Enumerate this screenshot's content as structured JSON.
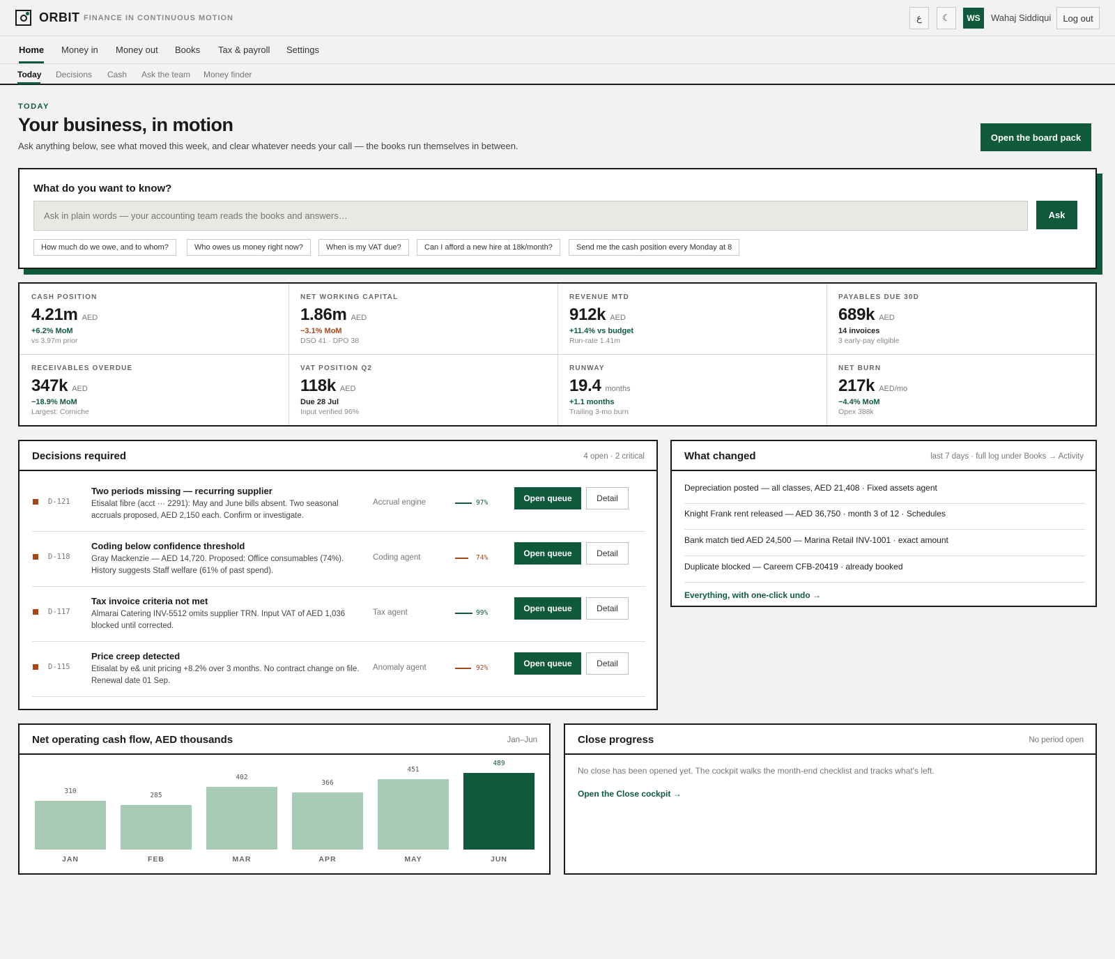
{
  "header": {
    "brand": "ORBIT",
    "tagline": "FINANCE IN CONTINUOUS MOTION",
    "lang_toggle": "ع",
    "theme_toggle": "☾",
    "avatar_initials": "WS",
    "user_name": "Wahaj Siddiqui",
    "logout_label": "Log out"
  },
  "nav": {
    "items": [
      "Home",
      "Money in",
      "Money out",
      "Books",
      "Tax & payroll",
      "Settings"
    ],
    "active": "Home"
  },
  "subnav": {
    "items": [
      "Today",
      "Decisions",
      "Cash",
      "Ask the team",
      "Money finder"
    ],
    "active": "Today"
  },
  "hero": {
    "eyebrow": "TODAY",
    "title": "Your business, in motion",
    "subtitle": "Ask anything below, see what moved this week, and clear whatever needs your call — the books run themselves in between.",
    "board_button": "Open the board pack"
  },
  "ask": {
    "title": "What do you want to know?",
    "placeholder": "Ask in plain words — your accounting team reads the books and answers…",
    "button": "Ask",
    "suggestions": [
      "How much do we owe, and to whom?",
      "Who owes us money right now?",
      "When is my VAT due?",
      "Can I afford a new hire at 18k/month?",
      "Send me the cash position every Monday at 8"
    ]
  },
  "kpis": [
    {
      "label": "CASH POSITION",
      "value": "4.21m",
      "unit": "AED",
      "delta": "+6.2% MoM",
      "note": "vs 3.97m prior"
    },
    {
      "label": "NET WORKING CAPITAL",
      "value": "1.86m",
      "unit": "AED",
      "delta": "−3.1% MoM",
      "note": "DSO 41 · DPO 38"
    },
    {
      "label": "REVENUE MTD",
      "value": "912k",
      "unit": "AED",
      "delta": "+11.4% vs budget",
      "note": "Run-rate 1.41m"
    },
    {
      "label": "PAYABLES DUE 30D",
      "value": "689k",
      "unit": "AED",
      "delta": "14 invoices",
      "note": "3 early-pay eligible"
    },
    {
      "label": "RECEIVABLES OVERDUE",
      "value": "347k",
      "unit": "AED",
      "delta": "−18.9% MoM",
      "note": "Largest: Corniche"
    },
    {
      "label": "VAT POSITION Q2",
      "value": "118k",
      "unit": "AED",
      "delta": "Due 28 Jul",
      "note": "Input verified 96%"
    },
    {
      "label": "RUNWAY",
      "value": "19.4",
      "unit": "months",
      "delta": "+1.1 months",
      "note": "Trailing 3-mo burn"
    },
    {
      "label": "NET BURN",
      "value": "217k",
      "unit": "AED/mo",
      "delta": "−4.4% MoM",
      "note": "Opex 388k"
    }
  ],
  "kpi_colors": {
    "up": "#0f5a3c",
    "down": "#a8461a"
  },
  "decisions": {
    "title": "Decisions required",
    "meta": "4 open · 2 critical",
    "open_label": "Open queue",
    "detail_label": "Detail",
    "items": [
      {
        "id": "D-121",
        "title": "Two periods missing — recurring supplier",
        "desc": "Etisalat fibre (acct ··· 2291): May and June bills absent. Two seasonal accruals proposed, AED 2,150 each. Confirm or investigate.",
        "agent": "Accrual engine",
        "confidence": "97%",
        "conf_color": "#0f5a3c"
      },
      {
        "id": "D-118",
        "title": "Coding below confidence threshold",
        "desc": "Gray Mackenzie — AED 14,720. Proposed: Office consumables (74%). History suggests Staff welfare (61% of past spend).",
        "agent": "Coding agent",
        "confidence": "74%",
        "conf_color": "#a8461a"
      },
      {
        "id": "D-117",
        "title": "Tax invoice criteria not met",
        "desc": "Almarai Catering INV-5512 omits supplier TRN. Input VAT of AED 1,036 blocked until corrected.",
        "agent": "Tax agent",
        "confidence": "99%",
        "conf_color": "#0f5a3c"
      },
      {
        "id": "D-115",
        "title": "Price creep detected",
        "desc": "Etisalat by e& unit pricing +8.2% over 3 months. No contract change on file. Renewal date 01 Sep.",
        "agent": "Anomaly agent",
        "confidence": "92%",
        "conf_color": "#a8461a"
      }
    ]
  },
  "changes": {
    "title": "What changed",
    "meta": "last 7 days · full log under Books → Activity",
    "items": [
      "Depreciation posted — all classes, AED 21,408 · Fixed assets agent",
      "Knight Frank rent released — AED 36,750 · month 3 of 12 · Schedules",
      "Bank match tied AED 24,500 — Marina Retail INV-1001 · exact amount",
      "Duplicate blocked — Careem CFB-20419 · already booked"
    ],
    "link": "Everything, with one-click undo →"
  },
  "cashflow": {
    "title": "Net operating cash flow, AED thousands",
    "meta": "Jan–Jun"
  },
  "chart_data": {
    "type": "bar",
    "title": "Net operating cash flow, AED thousands",
    "categories": [
      "JAN",
      "FEB",
      "MAR",
      "APR",
      "MAY",
      "JUN"
    ],
    "values": [
      310,
      285,
      402,
      366,
      451,
      489
    ],
    "highlight_index": 5,
    "colors": {
      "default": "#a8cbb6",
      "highlight": "#0f5a3c"
    },
    "grid": false
  },
  "close": {
    "title": "Close progress",
    "meta": "No period open",
    "text": "No close has been opened yet. The cockpit walks the month-end checklist and tracks what's left.",
    "link": "Open the Close cockpit →"
  }
}
